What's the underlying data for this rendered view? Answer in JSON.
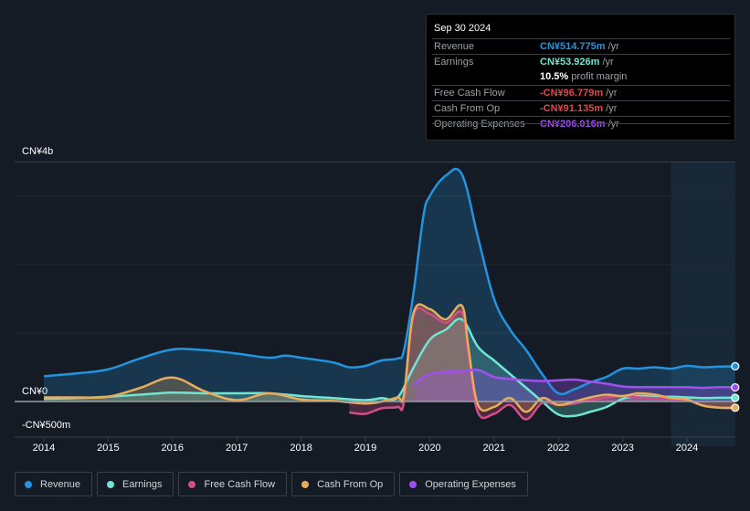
{
  "tooltip": {
    "date": "Sep 30 2024",
    "rows": [
      {
        "label": "Revenue",
        "value": "CN¥514.775m",
        "unit": " /yr",
        "color": "#2394df"
      },
      {
        "label": "Earnings",
        "value": "CN¥53.926m",
        "unit": " /yr",
        "color": "#6ee6d2"
      },
      {
        "label": "",
        "value": "10.5%",
        "unit": " profit margin",
        "color": "#ffffff"
      },
      {
        "label": "Free Cash Flow",
        "value": "-CN¥96.779m",
        "unit": " /yr",
        "color": "#e04848"
      },
      {
        "label": "Cash From Op",
        "value": "-CN¥91.135m",
        "unit": " /yr",
        "color": "#e04848"
      },
      {
        "label": "Operating Expenses",
        "value": "CN¥206.016m",
        "unit": " /yr",
        "color": "#a24ff0"
      }
    ]
  },
  "chart_data": {
    "type": "area",
    "title": "",
    "xlabel": "",
    "ylabel": "",
    "y_axis_labels": [
      "CN¥4b",
      "CN¥0",
      "-CN¥500m"
    ],
    "x_tick_labels": [
      "2014",
      "2015",
      "2016",
      "2017",
      "2018",
      "2019",
      "2020",
      "2021",
      "2022",
      "2023",
      "2024"
    ],
    "xlim": [
      2014,
      2024.75
    ],
    "ylim": [
      -0.55,
      3.5
    ],
    "units": "CN¥ billions",
    "grid": true,
    "forecast_shade_from": 2023.75,
    "legend_position": "bottom",
    "series": [
      {
        "name": "Revenue",
        "color": "#2394df",
        "x": [
          2014,
          2014.5,
          2015,
          2015.5,
          2016,
          2016.5,
          2017,
          2017.5,
          2017.75,
          2018,
          2018.5,
          2018.75,
          2019,
          2019.25,
          2019.5,
          2019.6,
          2019.75,
          2019.9,
          2020,
          2020.25,
          2020.5,
          2020.75,
          2021,
          2021.25,
          2021.5,
          2021.75,
          2022,
          2022.25,
          2022.5,
          2022.75,
          2023,
          2023.25,
          2023.5,
          2023.75,
          2024,
          2024.25,
          2024.5,
          2024.75
        ],
        "y": [
          0.37,
          0.41,
          0.47,
          0.63,
          0.76,
          0.75,
          0.7,
          0.64,
          0.67,
          0.64,
          0.57,
          0.5,
          0.52,
          0.6,
          0.63,
          0.75,
          1.6,
          2.7,
          3.0,
          3.3,
          3.32,
          2.4,
          1.5,
          1.05,
          0.75,
          0.4,
          0.12,
          0.18,
          0.28,
          0.36,
          0.48,
          0.48,
          0.5,
          0.48,
          0.52,
          0.5,
          0.51,
          0.515
        ]
      },
      {
        "name": "Earnings",
        "color": "#6ee6d2",
        "x": [
          2014,
          2014.5,
          2015,
          2015.5,
          2016,
          2016.5,
          2017,
          2017.5,
          2018,
          2018.5,
          2019,
          2019.25,
          2019.5,
          2019.75,
          2020,
          2020.25,
          2020.5,
          2020.75,
          2021,
          2021.25,
          2021.5,
          2021.75,
          2022,
          2022.25,
          2022.5,
          2022.75,
          2023,
          2023.25,
          2023.5,
          2023.75,
          2024,
          2024.25,
          2024.5,
          2024.75
        ],
        "y": [
          0.04,
          0.05,
          0.07,
          0.1,
          0.13,
          0.12,
          0.12,
          0.12,
          0.08,
          0.05,
          0.02,
          0.05,
          0.06,
          0.5,
          0.9,
          1.05,
          1.2,
          0.8,
          0.6,
          0.4,
          0.2,
          0.0,
          -0.19,
          -0.21,
          -0.15,
          -0.08,
          0.04,
          0.08,
          0.07,
          0.07,
          0.06,
          0.05,
          0.055,
          0.054
        ]
      },
      {
        "name": "Free Cash Flow",
        "color": "#d34d86",
        "x": [
          2018.75,
          2019,
          2019.25,
          2019.5,
          2019.6,
          2019.75,
          2020,
          2020.25,
          2020.5,
          2020.6,
          2020.75,
          2021,
          2021.25,
          2021.5,
          2021.75,
          2022,
          2022.25,
          2022.5,
          2022.75,
          2023,
          2023.25,
          2023.5,
          2023.75,
          2024,
          2024.25,
          2024.5,
          2024.75
        ],
        "y": [
          -0.16,
          -0.18,
          -0.1,
          -0.08,
          0.0,
          1.25,
          1.28,
          1.15,
          1.3,
          0.7,
          -0.16,
          -0.18,
          -0.05,
          -0.26,
          -0.02,
          -0.05,
          -0.03,
          0.02,
          0.06,
          0.08,
          0.06,
          0.05,
          0.04,
          0.02,
          -0.06,
          -0.09,
          -0.097
        ]
      },
      {
        "name": "Cash From Op",
        "color": "#e8ad5c",
        "x": [
          2014,
          2014.5,
          2015,
          2015.5,
          2016,
          2016.5,
          2017,
          2017.5,
          2018,
          2018.5,
          2019,
          2019.25,
          2019.5,
          2019.6,
          2019.75,
          2020,
          2020.25,
          2020.5,
          2020.6,
          2020.75,
          2021,
          2021.25,
          2021.5,
          2021.75,
          2022,
          2022.25,
          2022.5,
          2022.75,
          2023,
          2023.25,
          2023.5,
          2023.75,
          2024,
          2024.25,
          2024.5,
          2024.75
        ],
        "y": [
          0.06,
          0.06,
          0.07,
          0.2,
          0.35,
          0.15,
          0.02,
          0.12,
          0.03,
          0.01,
          -0.03,
          0.0,
          0.06,
          0.1,
          1.3,
          1.35,
          1.2,
          1.4,
          0.8,
          -0.05,
          -0.08,
          0.05,
          -0.15,
          0.05,
          -0.05,
          0.0,
          0.06,
          0.1,
          0.08,
          0.12,
          0.1,
          0.05,
          0.03,
          -0.06,
          -0.09,
          -0.091
        ]
      },
      {
        "name": "Operating Expenses",
        "color": "#a24ff0",
        "x": [
          2019.75,
          2020,
          2020.25,
          2020.5,
          2020.75,
          2021,
          2021.25,
          2021.5,
          2021.75,
          2022,
          2022.25,
          2022.5,
          2022.75,
          2023,
          2023.25,
          2023.5,
          2023.75,
          2024,
          2024.25,
          2024.5,
          2024.75
        ],
        "y": [
          0.25,
          0.4,
          0.43,
          0.44,
          0.46,
          0.36,
          0.33,
          0.31,
          0.3,
          0.31,
          0.32,
          0.29,
          0.26,
          0.22,
          0.21,
          0.21,
          0.21,
          0.21,
          0.2,
          0.21,
          0.206
        ]
      }
    ]
  },
  "legend": [
    {
      "label": "Revenue",
      "color": "#2394df"
    },
    {
      "label": "Earnings",
      "color": "#6ee6d2"
    },
    {
      "label": "Free Cash Flow",
      "color": "#d34d86"
    },
    {
      "label": "Cash From Op",
      "color": "#e8ad5c"
    },
    {
      "label": "Operating Expenses",
      "color": "#a24ff0"
    }
  ]
}
